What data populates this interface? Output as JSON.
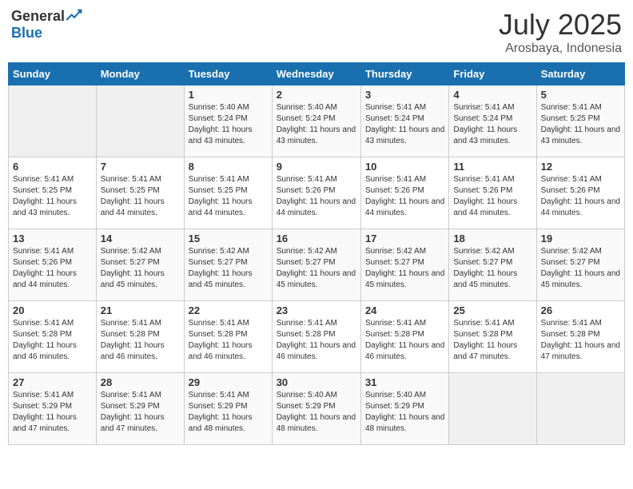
{
  "header": {
    "logo_general": "General",
    "logo_blue": "Blue",
    "month_year": "July 2025",
    "location": "Arosbaya, Indonesia"
  },
  "weekdays": [
    "Sunday",
    "Monday",
    "Tuesday",
    "Wednesday",
    "Thursday",
    "Friday",
    "Saturday"
  ],
  "weeks": [
    [
      {
        "day": "",
        "info": ""
      },
      {
        "day": "",
        "info": ""
      },
      {
        "day": "1",
        "info": "Sunrise: 5:40 AM\nSunset: 5:24 PM\nDaylight: 11 hours and 43 minutes."
      },
      {
        "day": "2",
        "info": "Sunrise: 5:40 AM\nSunset: 5:24 PM\nDaylight: 11 hours and 43 minutes."
      },
      {
        "day": "3",
        "info": "Sunrise: 5:41 AM\nSunset: 5:24 PM\nDaylight: 11 hours and 43 minutes."
      },
      {
        "day": "4",
        "info": "Sunrise: 5:41 AM\nSunset: 5:24 PM\nDaylight: 11 hours and 43 minutes."
      },
      {
        "day": "5",
        "info": "Sunrise: 5:41 AM\nSunset: 5:25 PM\nDaylight: 11 hours and 43 minutes."
      }
    ],
    [
      {
        "day": "6",
        "info": "Sunrise: 5:41 AM\nSunset: 5:25 PM\nDaylight: 11 hours and 43 minutes."
      },
      {
        "day": "7",
        "info": "Sunrise: 5:41 AM\nSunset: 5:25 PM\nDaylight: 11 hours and 44 minutes."
      },
      {
        "day": "8",
        "info": "Sunrise: 5:41 AM\nSunset: 5:25 PM\nDaylight: 11 hours and 44 minutes."
      },
      {
        "day": "9",
        "info": "Sunrise: 5:41 AM\nSunset: 5:26 PM\nDaylight: 11 hours and 44 minutes."
      },
      {
        "day": "10",
        "info": "Sunrise: 5:41 AM\nSunset: 5:26 PM\nDaylight: 11 hours and 44 minutes."
      },
      {
        "day": "11",
        "info": "Sunrise: 5:41 AM\nSunset: 5:26 PM\nDaylight: 11 hours and 44 minutes."
      },
      {
        "day": "12",
        "info": "Sunrise: 5:41 AM\nSunset: 5:26 PM\nDaylight: 11 hours and 44 minutes."
      }
    ],
    [
      {
        "day": "13",
        "info": "Sunrise: 5:41 AM\nSunset: 5:26 PM\nDaylight: 11 hours and 44 minutes."
      },
      {
        "day": "14",
        "info": "Sunrise: 5:42 AM\nSunset: 5:27 PM\nDaylight: 11 hours and 45 minutes."
      },
      {
        "day": "15",
        "info": "Sunrise: 5:42 AM\nSunset: 5:27 PM\nDaylight: 11 hours and 45 minutes."
      },
      {
        "day": "16",
        "info": "Sunrise: 5:42 AM\nSunset: 5:27 PM\nDaylight: 11 hours and 45 minutes."
      },
      {
        "day": "17",
        "info": "Sunrise: 5:42 AM\nSunset: 5:27 PM\nDaylight: 11 hours and 45 minutes."
      },
      {
        "day": "18",
        "info": "Sunrise: 5:42 AM\nSunset: 5:27 PM\nDaylight: 11 hours and 45 minutes."
      },
      {
        "day": "19",
        "info": "Sunrise: 5:42 AM\nSunset: 5:27 PM\nDaylight: 11 hours and 45 minutes."
      }
    ],
    [
      {
        "day": "20",
        "info": "Sunrise: 5:41 AM\nSunset: 5:28 PM\nDaylight: 11 hours and 46 minutes."
      },
      {
        "day": "21",
        "info": "Sunrise: 5:41 AM\nSunset: 5:28 PM\nDaylight: 11 hours and 46 minutes."
      },
      {
        "day": "22",
        "info": "Sunrise: 5:41 AM\nSunset: 5:28 PM\nDaylight: 11 hours and 46 minutes."
      },
      {
        "day": "23",
        "info": "Sunrise: 5:41 AM\nSunset: 5:28 PM\nDaylight: 11 hours and 46 minutes."
      },
      {
        "day": "24",
        "info": "Sunrise: 5:41 AM\nSunset: 5:28 PM\nDaylight: 11 hours and 46 minutes."
      },
      {
        "day": "25",
        "info": "Sunrise: 5:41 AM\nSunset: 5:28 PM\nDaylight: 11 hours and 47 minutes."
      },
      {
        "day": "26",
        "info": "Sunrise: 5:41 AM\nSunset: 5:28 PM\nDaylight: 11 hours and 47 minutes."
      }
    ],
    [
      {
        "day": "27",
        "info": "Sunrise: 5:41 AM\nSunset: 5:29 PM\nDaylight: 11 hours and 47 minutes."
      },
      {
        "day": "28",
        "info": "Sunrise: 5:41 AM\nSunset: 5:29 PM\nDaylight: 11 hours and 47 minutes."
      },
      {
        "day": "29",
        "info": "Sunrise: 5:41 AM\nSunset: 5:29 PM\nDaylight: 11 hours and 48 minutes."
      },
      {
        "day": "30",
        "info": "Sunrise: 5:40 AM\nSunset: 5:29 PM\nDaylight: 11 hours and 48 minutes."
      },
      {
        "day": "31",
        "info": "Sunrise: 5:40 AM\nSunset: 5:29 PM\nDaylight: 11 hours and 48 minutes."
      },
      {
        "day": "",
        "info": ""
      },
      {
        "day": "",
        "info": ""
      }
    ]
  ]
}
